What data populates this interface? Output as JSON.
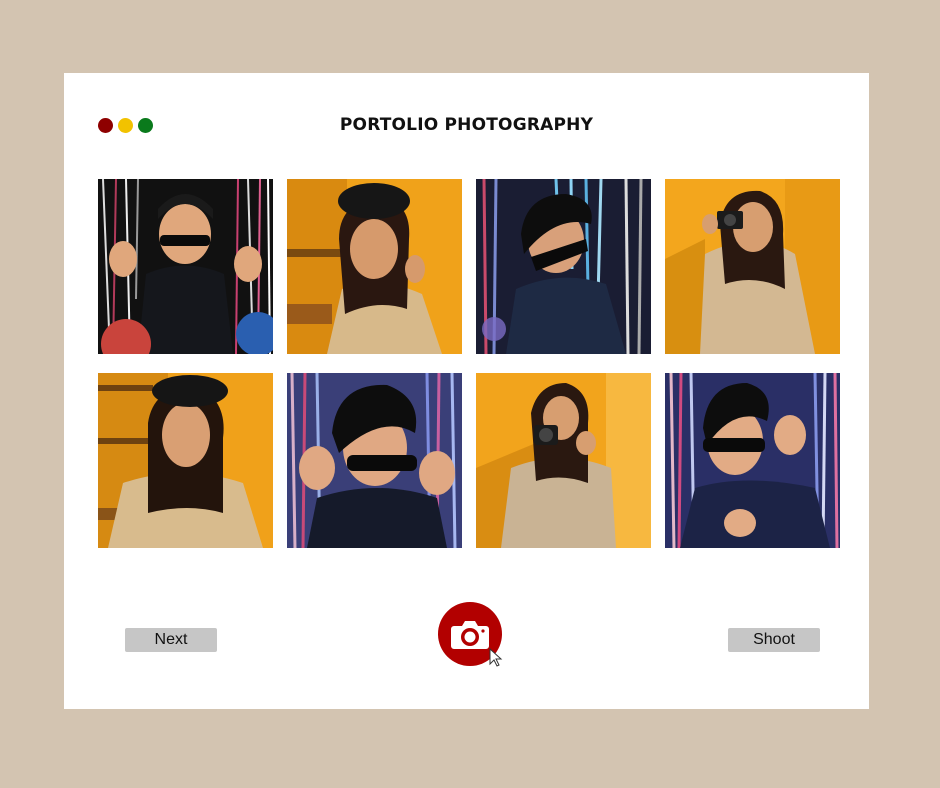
{
  "window": {
    "title": "PORTOLIO PHOTOGRAPHY",
    "controls": [
      {
        "name": "close",
        "color": "#8e0000"
      },
      {
        "name": "minimize",
        "color": "#f2c200"
      },
      {
        "name": "maximize",
        "color": "#0a7a1c"
      }
    ]
  },
  "gallery": {
    "photos": [
      {
        "alt": "person in sunglasses with hand gestures in front of tinsel curtain"
      },
      {
        "alt": "person in beret and jacket against yellow wall"
      },
      {
        "alt": "person in sunglasses in front of blue tinsel curtain"
      },
      {
        "alt": "person holding camera against yellow wall"
      },
      {
        "alt": "person in beret looking down against yellow wall"
      },
      {
        "alt": "person adjusting sunglasses in front of tinsel curtain"
      },
      {
        "alt": "person with camera in front of yellow wall"
      },
      {
        "alt": "smiling person holding sunglasses in front of tinsel curtain"
      }
    ]
  },
  "controls": {
    "next_label": "Next",
    "shoot_label": "Shoot",
    "shutter_icon": "camera-icon",
    "accent": "#b20000"
  }
}
